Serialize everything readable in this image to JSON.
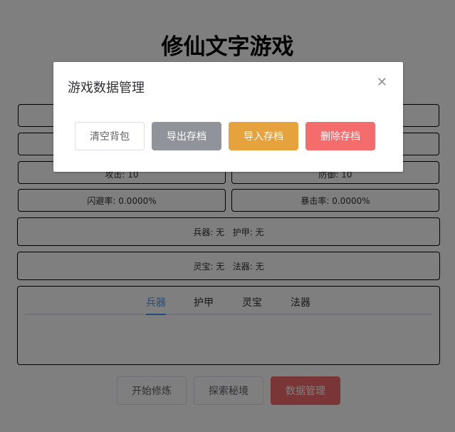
{
  "page": {
    "title": "修仙文字游戏"
  },
  "stats": {
    "attack": "攻击: 10",
    "defense": "防御: 10",
    "dodge": "闪避率: 0.0000%",
    "crit": "暴击率: 0.0000%",
    "equip1": "兵器: 无   护甲: 无",
    "equip2": "灵宝: 无   法器: 无"
  },
  "tabs": [
    {
      "label": "兵器",
      "active": true
    },
    {
      "label": "护甲"
    },
    {
      "label": "灵宝"
    },
    {
      "label": "法器"
    }
  ],
  "actions": {
    "cultivate": "开始修炼",
    "explore": "探索秘境",
    "data": "数据管理"
  },
  "dialog": {
    "title": "游戏数据管理",
    "close_icon": "close-icon",
    "clear": "清空背包",
    "export": "导出存档",
    "import": "导入存档",
    "delete": "删除存档"
  },
  "colors": {
    "primary": "#409eff",
    "info": "#909399",
    "warning": "#e6a23c",
    "danger": "#f56c6c"
  }
}
